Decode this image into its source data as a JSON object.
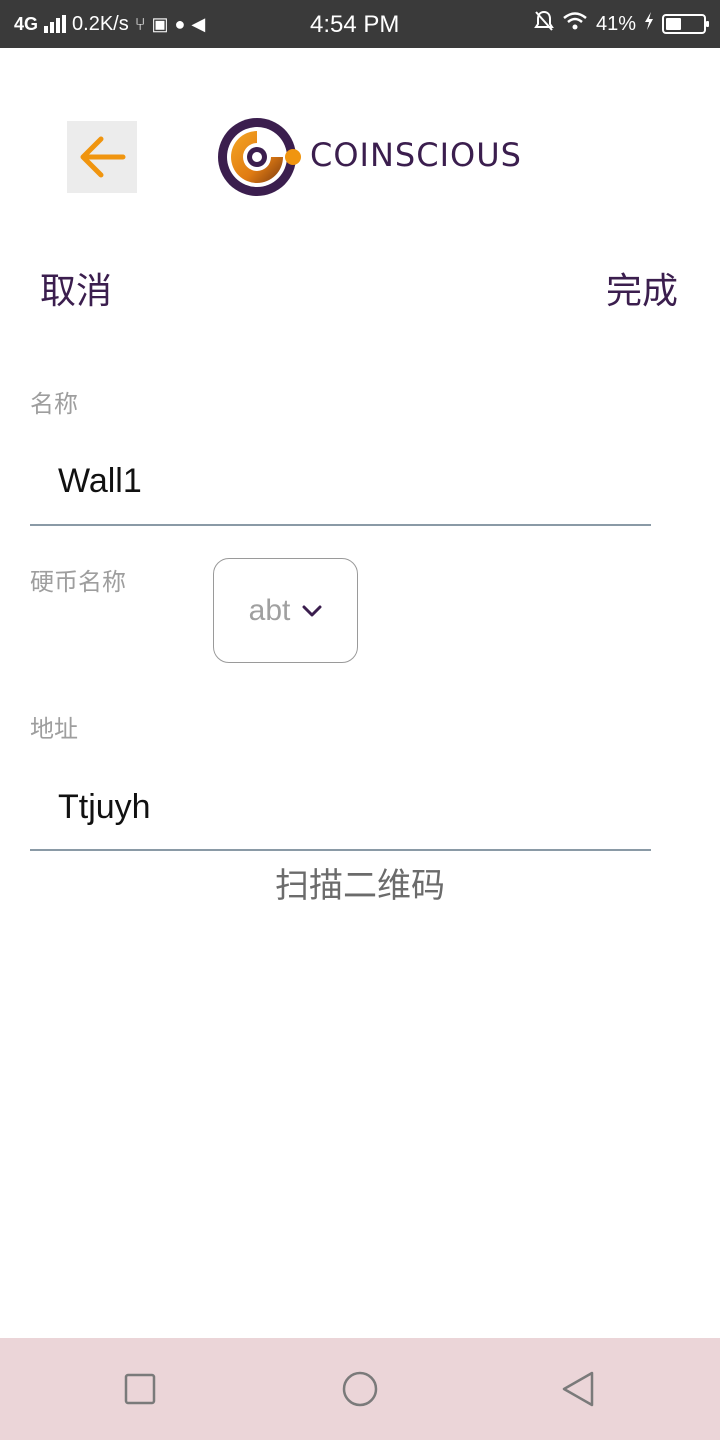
{
  "status_bar": {
    "network": "4G",
    "speed": "0.2K/s",
    "time": "4:54 PM",
    "battery_percent": "41%",
    "battery_level": 0.41
  },
  "header": {
    "back_icon": "arrow-left-icon",
    "logo_text": "COINSCIOUS",
    "accent_color": "#f0950f",
    "brand_color": "#3b1e4e"
  },
  "actions": {
    "cancel_label": "取消",
    "done_label": "完成"
  },
  "form": {
    "name_label": "名称",
    "name_value": "Wall1",
    "coin_label": "硬币名称",
    "coin_selected": "abt",
    "address_label": "地址",
    "address_value": "Ttjuyh",
    "scan_label": "扫描二维码"
  },
  "nav_bar": {
    "buttons": [
      "square-icon",
      "circle-icon",
      "triangle-back-icon"
    ]
  }
}
